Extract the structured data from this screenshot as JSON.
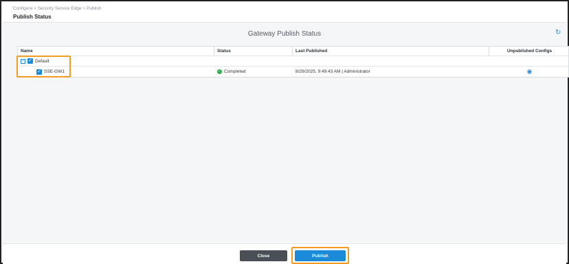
{
  "header": {
    "breadcrumb": "Configure > Security Service Edge > Publish",
    "title": "Publish Status"
  },
  "main": {
    "section_title": "Gateway Publish Status",
    "refresh_icon": "refresh-icon"
  },
  "table": {
    "columns": {
      "name": "Name",
      "status": "Status",
      "last_published": "Last Published",
      "unpublished": "Unpublished Configs"
    },
    "group": {
      "name": "Default",
      "expanded": true,
      "checked": true
    },
    "rows": [
      {
        "name": "SSE-GW1",
        "checked": true,
        "status": "Completed",
        "status_color": "#2eaa4a",
        "last_published": "8/29/2025, 9:49:43 AM | Administrator",
        "unpublished_icon": "eye-icon"
      }
    ]
  },
  "footer": {
    "close_label": "Close",
    "publish_label": "Publish"
  },
  "colors": {
    "accent": "#1a8ad9",
    "highlight": "#f39a22",
    "close_button": "#4a4f56"
  }
}
